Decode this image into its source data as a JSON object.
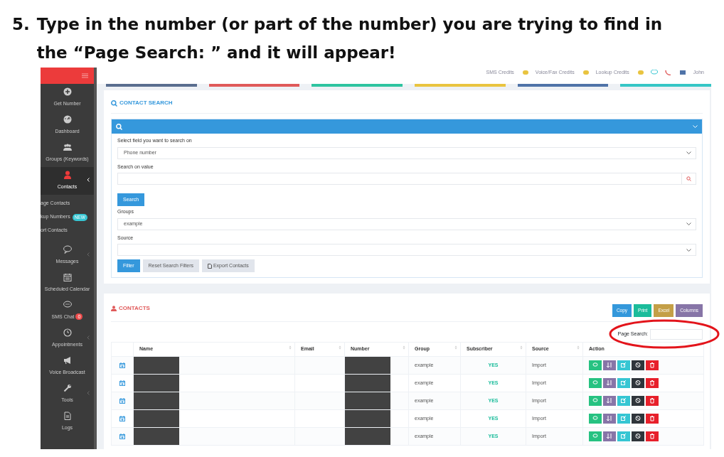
{
  "slide": {
    "step": "5.",
    "instruction_lines": [
      "Type in the number (or part of the number) you are trying to find in",
      "the “Page Search: ” and it will appear!"
    ]
  },
  "topbar": {
    "credits": [
      {
        "label": "SMS Credits"
      },
      {
        "label": "Voice/Fax Credits"
      },
      {
        "label": "Lookup Credits"
      }
    ],
    "user": "John"
  },
  "sidebar": {
    "items": [
      {
        "label": "Get Number",
        "selected": false,
        "submenu": false
      },
      {
        "label": "Dashboard",
        "selected": false,
        "submenu": false
      },
      {
        "label": "Groups (Keywords)",
        "selected": false,
        "submenu": false
      },
      {
        "label": "Contacts",
        "selected": true,
        "submenu": true,
        "expanded": true,
        "children": [
          {
            "label": "age Contacts"
          },
          {
            "label": "kup Numbers",
            "badge": "NEW"
          },
          {
            "label": "ort Contacts"
          }
        ]
      },
      {
        "label": "Messages",
        "selected": false,
        "submenu": true,
        "expanded": false
      },
      {
        "label": "Scheduled Calendar",
        "selected": false,
        "submenu": false
      },
      {
        "label": "SMS Chat",
        "selected": false,
        "submenu": false,
        "badge": "0"
      },
      {
        "label": "Appointments",
        "selected": false,
        "submenu": true,
        "expanded": false
      },
      {
        "label": "Voice Broadcast",
        "selected": false,
        "submenu": false
      },
      {
        "label": "Tools",
        "selected": false,
        "submenu": true,
        "expanded": false
      },
      {
        "label": "Logs",
        "selected": false,
        "submenu": false
      }
    ]
  },
  "stat_cards": [
    {
      "color": "#5a6e8f"
    },
    {
      "color": "#e05a5a"
    },
    {
      "color": "#2ec4a0"
    },
    {
      "color": "#e9c440"
    },
    {
      "color": "#4f73a8"
    },
    {
      "color": "#36c6c6"
    }
  ],
  "contact_search": {
    "title": "CONTACT SEARCH",
    "fields": [
      {
        "kind": "select",
        "label": "Select field you want to search on",
        "value": "Phone number"
      },
      {
        "kind": "search",
        "label": "Search on value"
      },
      {
        "kind": "button",
        "label": "Search"
      },
      {
        "kind": "select",
        "label": "Groups",
        "value": "example"
      },
      {
        "kind": "select",
        "label": "Source"
      }
    ],
    "buttons": [
      {
        "label": "Filter",
        "kind": "primary"
      },
      {
        "label": "Reset Search Filters",
        "kind": "plain"
      },
      {
        "label": "Export Contacts",
        "kind": "plain"
      }
    ]
  },
  "contacts": {
    "title": "CONTACTS",
    "export_buttons": [
      {
        "label": "Copy",
        "color": "#3498db"
      },
      {
        "label": "Print",
        "color": "#1bbc9b"
      },
      {
        "label": "Excel",
        "color": "#c49f47"
      },
      {
        "label": "Columns",
        "color": "#8775a7"
      }
    ],
    "page_search": {
      "label": "Page Search:"
    },
    "columns": [
      "Name",
      "Email",
      "Number",
      "Group",
      "Subscriber",
      "Source",
      "Action"
    ],
    "rows": [
      {
        "redacted": true,
        "group": "example",
        "subscriber": "YES",
        "source": "Import"
      },
      {
        "redacted": true,
        "group": "example",
        "subscriber": "YES",
        "source": "Import"
      },
      {
        "redacted": true,
        "group": "example",
        "subscriber": "YES",
        "source": "Import"
      },
      {
        "redacted": true,
        "group": "example",
        "subscriber": "YES",
        "source": "Import"
      },
      {
        "redacted": true,
        "group": "example",
        "subscriber": "YES",
        "source": "Import"
      }
    ]
  },
  "annotation": {
    "kind": "ellipse"
  }
}
